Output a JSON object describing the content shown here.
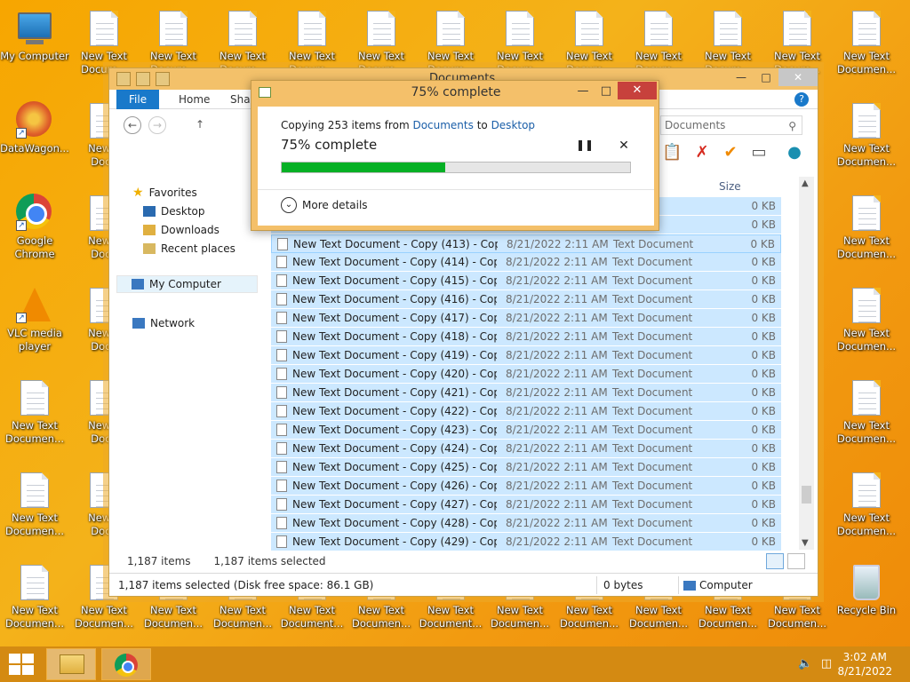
{
  "desktop": {
    "icons_top_row": [
      "My Computer",
      "New Text\nDocum...",
      "New Text\nDocum...",
      "New Text\nDocum...",
      "New Text\nDocum...",
      "New Text\nDocum...",
      "New Text\nDocum...",
      "New Text\nDocum...",
      "New Text\nDocum...",
      "New Text\nDocum...",
      "New Text\nDocum...",
      "New Text\nDocum...",
      "New Text\nDocumen..."
    ],
    "left_col": [
      {
        "label": "DataWagon...",
        "icon": "datawagon-icon"
      },
      {
        "label": "Google\nChrome",
        "icon": "chrome-icon"
      },
      {
        "label": "VLC media\nplayer",
        "icon": "vlc-icon"
      },
      {
        "label": "New Text\nDocumen...",
        "icon": "text-document-icon"
      },
      {
        "label": "New Text\nDocumen...",
        "icon": "text-document-icon"
      },
      {
        "label": "New Text\nDocumen...",
        "icon": "text-document-icon"
      }
    ],
    "second_col": [
      "New T\nDocu",
      "New T\nDocu",
      "New T\nDocu",
      "New T\nDocu",
      "New T\nDocu",
      "New T\nDocu"
    ],
    "right_col": [
      "New Text\nDocumen...",
      "New Text\nDocumen...",
      "New Text\nDocumen...",
      "New Text\nDocumen...",
      "New Text\nDocumen..."
    ],
    "bottom_row": [
      "New Text\nDocumen...",
      "New Text\nDocumen...",
      "New Text\nDocumen...",
      "New Text\nDocumen...",
      "New Text\nDocument...",
      "New Text\nDocumen...",
      "New Text\nDocument...",
      "New Text\nDocumen...",
      "New Text\nDocumen...",
      "New Text\nDocumen...",
      "New Text\nDocumen...",
      "New Text\nDocumen..."
    ],
    "recycle_bin": "Recycle Bin"
  },
  "explorer": {
    "title": "Documents",
    "tabs": {
      "file": "File",
      "home": "Home",
      "share": "Shar"
    },
    "help": "?",
    "search_placeholder": "Documents",
    "column_size": "Size",
    "nav": {
      "favorites": "Favorites",
      "desktop": "Desktop",
      "downloads": "Downloads",
      "recent": "Recent places",
      "my_computer": "My Computer",
      "network": "Network"
    },
    "rows": [
      {
        "name": "",
        "date": "",
        "type": "ument",
        "size": "0 KB"
      },
      {
        "name": "",
        "date": "",
        "type": "ument",
        "size": "0 KB"
      },
      {
        "name": "New Text Document - Copy (413) - Copy...",
        "date": "8/21/2022 2:11 AM",
        "type": "Text Document",
        "size": "0 KB"
      },
      {
        "name": "New Text Document - Copy (414) - Copy...",
        "date": "8/21/2022 2:11 AM",
        "type": "Text Document",
        "size": "0 KB"
      },
      {
        "name": "New Text Document - Copy (415) - Copy...",
        "date": "8/21/2022 2:11 AM",
        "type": "Text Document",
        "size": "0 KB"
      },
      {
        "name": "New Text Document - Copy (416) - Copy...",
        "date": "8/21/2022 2:11 AM",
        "type": "Text Document",
        "size": "0 KB"
      },
      {
        "name": "New Text Document - Copy (417) - Copy...",
        "date": "8/21/2022 2:11 AM",
        "type": "Text Document",
        "size": "0 KB"
      },
      {
        "name": "New Text Document - Copy (418) - Copy...",
        "date": "8/21/2022 2:11 AM",
        "type": "Text Document",
        "size": "0 KB"
      },
      {
        "name": "New Text Document - Copy (419) - Copy...",
        "date": "8/21/2022 2:11 AM",
        "type": "Text Document",
        "size": "0 KB"
      },
      {
        "name": "New Text Document - Copy (420) - Copy...",
        "date": "8/21/2022 2:11 AM",
        "type": "Text Document",
        "size": "0 KB"
      },
      {
        "name": "New Text Document - Copy (421) - Copy...",
        "date": "8/21/2022 2:11 AM",
        "type": "Text Document",
        "size": "0 KB"
      },
      {
        "name": "New Text Document - Copy (422) - Copy...",
        "date": "8/21/2022 2:11 AM",
        "type": "Text Document",
        "size": "0 KB"
      },
      {
        "name": "New Text Document - Copy (423) - Copy...",
        "date": "8/21/2022 2:11 AM",
        "type": "Text Document",
        "size": "0 KB"
      },
      {
        "name": "New Text Document - Copy (424) - Copy...",
        "date": "8/21/2022 2:11 AM",
        "type": "Text Document",
        "size": "0 KB"
      },
      {
        "name": "New Text Document - Copy (425) - Copy...",
        "date": "8/21/2022 2:11 AM",
        "type": "Text Document",
        "size": "0 KB"
      },
      {
        "name": "New Text Document - Copy (426) - Copy...",
        "date": "8/21/2022 2:11 AM",
        "type": "Text Document",
        "size": "0 KB"
      },
      {
        "name": "New Text Document - Copy (427) - Copy...",
        "date": "8/21/2022 2:11 AM",
        "type": "Text Document",
        "size": "0 KB"
      },
      {
        "name": "New Text Document - Copy (428) - Copy...",
        "date": "8/21/2022 2:11 AM",
        "type": "Text Document",
        "size": "0 KB"
      },
      {
        "name": "New Text Document - Copy (429) - Copy...",
        "date": "8/21/2022 2:11 AM",
        "type": "Text Document",
        "size": "0 KB"
      }
    ],
    "item_count": "1,187 items",
    "selected_count": "1,187 items selected",
    "status_selected": "1,187 items selected (Disk free space: 86.1 GB)",
    "status_bytes": "0 bytes",
    "status_location": "Computer"
  },
  "copy_dialog": {
    "title": "75% complete",
    "copy_prefix": "Copying 253 items from ",
    "source": "Documents",
    "to_word": " to ",
    "destination": "Desktop",
    "percent_text": "75% complete",
    "progress_percent": 47,
    "more_details": "More details"
  },
  "taskbar": {
    "time": "3:02 AM",
    "date": "8/21/2022"
  },
  "colors": {
    "accent": "#1979ca",
    "progress": "#06b025",
    "close": "#c7413c"
  }
}
